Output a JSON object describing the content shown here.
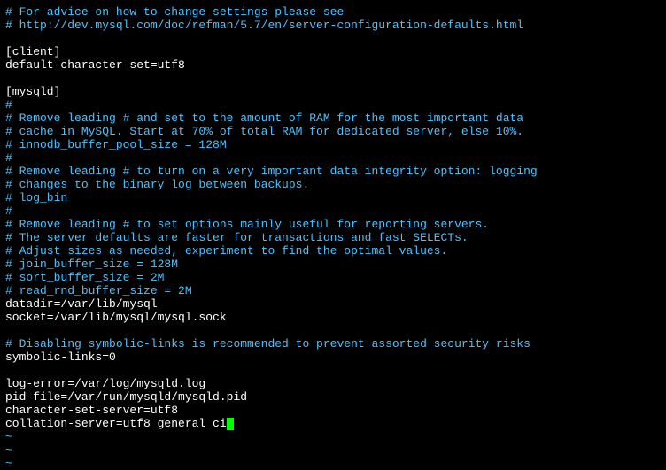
{
  "lines": {
    "l0": "# For advice on how to change settings please see",
    "l1": "# http://dev.mysql.com/doc/refman/5.7/en/server-configuration-defaults.html",
    "l2": "",
    "l3": "[client]",
    "l4": "default-character-set=utf8",
    "l5": "",
    "l6": "[mysqld]",
    "l7": "#",
    "l8": "# Remove leading # and set to the amount of RAM for the most important data",
    "l9": "# cache in MySQL. Start at 70% of total RAM for dedicated server, else 10%.",
    "l10": "# innodb_buffer_pool_size = 128M",
    "l11": "#",
    "l12": "# Remove leading # to turn on a very important data integrity option: logging",
    "l13": "# changes to the binary log between backups.",
    "l14": "# log_bin",
    "l15": "#",
    "l16": "# Remove leading # to set options mainly useful for reporting servers.",
    "l17": "# The server defaults are faster for transactions and fast SELECTs.",
    "l18": "# Adjust sizes as needed, experiment to find the optimal values.",
    "l19": "# join_buffer_size = 128M",
    "l20": "# sort_buffer_size = 2M",
    "l21": "# read_rnd_buffer_size = 2M",
    "l22": "datadir=/var/lib/mysql",
    "l23": "socket=/var/lib/mysql/mysql.sock",
    "l24": "",
    "l25": "# Disabling symbolic-links is recommended to prevent assorted security risks",
    "l26": "symbolic-links=0",
    "l27": "",
    "l28": "log-error=/var/log/mysqld.log",
    "l29": "pid-file=/var/run/mysqld/mysqld.pid",
    "l30": "character-set-server=utf8",
    "l31": "collation-server=utf8_general_ci",
    "tilde": "~"
  }
}
